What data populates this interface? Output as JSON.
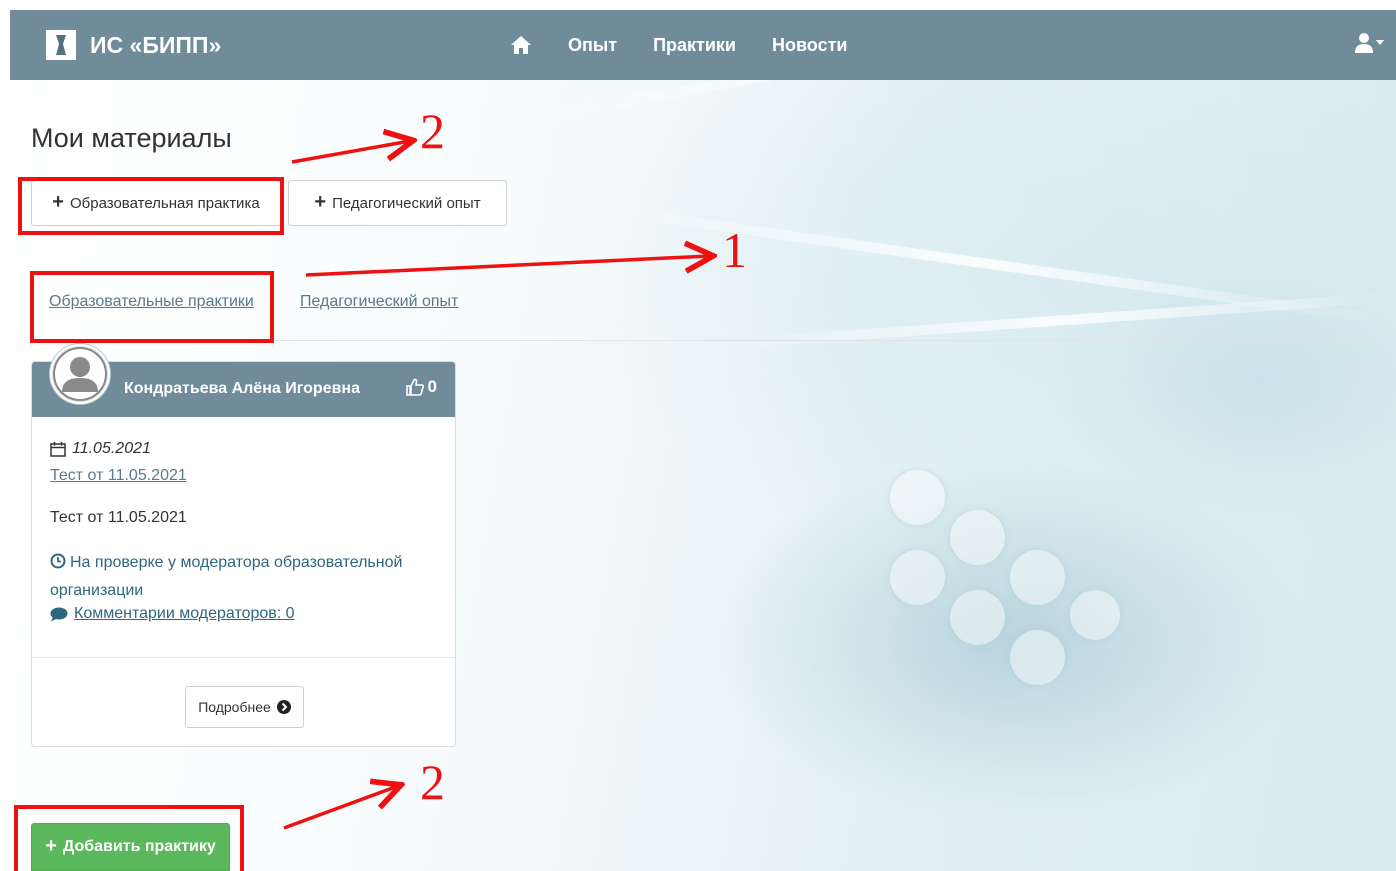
{
  "navbar": {
    "brand": "ИС «БИПП»",
    "links": [
      "Опыт",
      "Практики",
      "Новости"
    ]
  },
  "page": {
    "title": "Мои материалы",
    "buttons": {
      "add_practice_top": "Образовательная практика",
      "add_experience": "Педагогический опыт"
    },
    "tabs": [
      "Образовательные практики",
      "Педагогический опыт"
    ]
  },
  "card": {
    "author": "Кондратьева Алёна Игоревна",
    "likes": "0",
    "date": "11.05.2021",
    "link_title": "Тест от 11.05.2021",
    "text": "Тест от 11.05.2021",
    "status": "На проверке у модератора образовательной организации",
    "comments": "Комментарии модераторов: 0",
    "more_button": "Подробнее"
  },
  "add_button": "Добавить практику",
  "annotations": {
    "arrow_1": "1",
    "arrow_2_top": "2",
    "arrow_2_bottom": "2",
    "color": "#ee1111"
  },
  "colors": {
    "navbar": "#708c9b",
    "success": "#5cb85c",
    "link": "#5a7a8c"
  }
}
